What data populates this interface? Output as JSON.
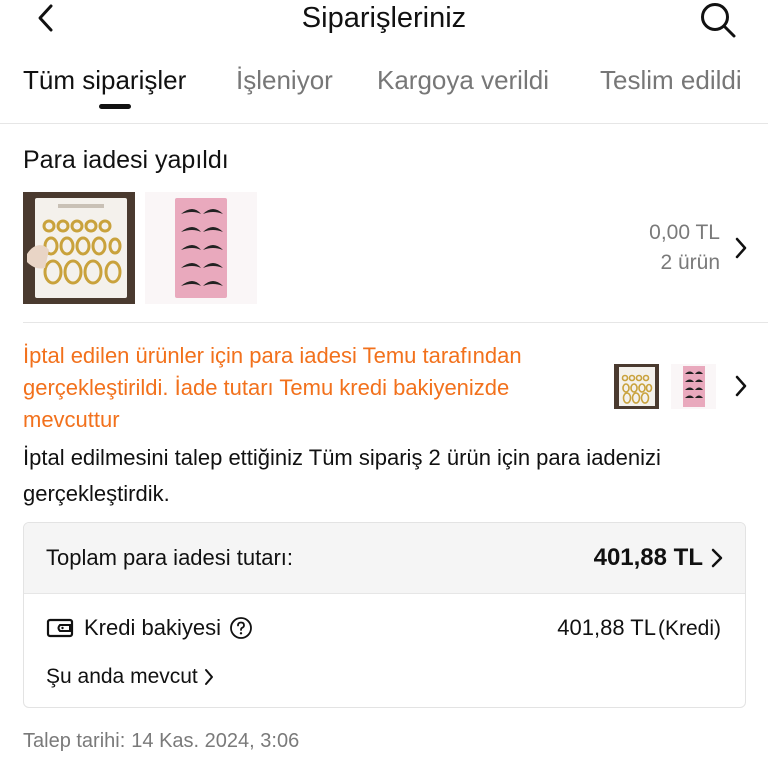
{
  "header": {
    "title": "Siparişleriniz",
    "back_icon": "chevron-left-icon",
    "search_icon": "search-icon"
  },
  "tabs": [
    {
      "label": "Tüm siparişler",
      "active": true
    },
    {
      "label": "İşleniyor",
      "active": false
    },
    {
      "label": "Kargoya verildi",
      "active": false
    },
    {
      "label": "Teslim edildi",
      "active": false
    }
  ],
  "order": {
    "status": "Para iadesi yapıldı",
    "products": [
      {
        "image": "gold-earrings-set"
      },
      {
        "image": "false-eyelashes-pack"
      }
    ],
    "total": "0,00 TL",
    "item_count": "2 ürün"
  },
  "notice": {
    "text": "İptal edilen ürünler için para iadesi Temu tarafından gerçekleştirildi. İade tutarı Temu kredi bakiyenizde mevcuttur",
    "color": "#f2711c"
  },
  "description": "İptal edilmesini talep ettiğiniz Tüm sipariş 2 ürün için para iadenizi gerçekleştirdik.",
  "refund": {
    "total_label": "Toplam para iadesi tutarı:",
    "total_amount": "401,88 TL",
    "credit_label": "Kredi bakiyesi",
    "credit_amount": "401,88 TL",
    "credit_suffix": "(Kredi)",
    "available_label": "Şu anda mevcut"
  },
  "request": {
    "label": "Talep tarihi:",
    "date": "14 Kas. 2024, 3:06"
  }
}
